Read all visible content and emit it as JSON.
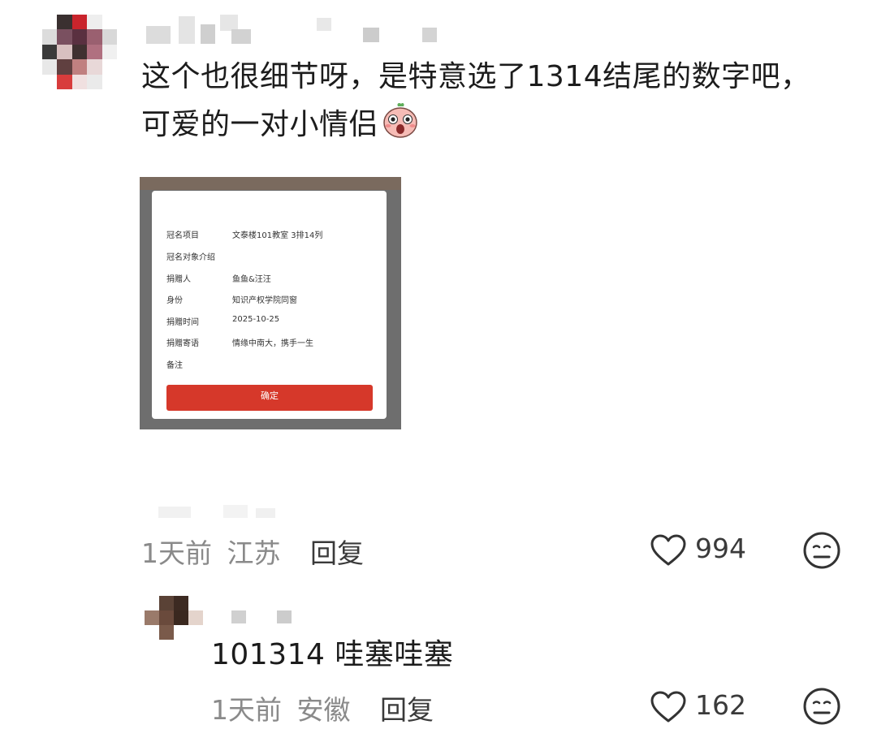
{
  "comments": [
    {
      "text_line1": "这个也很细节呀，是特意选了1314结尾的数字吧，",
      "text_line2": "可爱的一对小情侣",
      "emoji": "shocked-face-emoji",
      "time": "1天前",
      "location": "江苏",
      "reply_label": "回复",
      "likes": "994",
      "attached_image": {
        "fields": [
          {
            "key": "冠名项目",
            "value": "文泰楼101教室 3排14列"
          },
          {
            "key": "冠名对象介绍",
            "value": ""
          },
          {
            "key": "捐赠人",
            "value": "鱼鱼&汪汪"
          },
          {
            "key": "身份",
            "value": "知识产权学院同窗"
          },
          {
            "key": "捐赠时间",
            "value": "2025-10-25"
          },
          {
            "key": "捐赠寄语",
            "value": "情缘中南大，携手一生"
          },
          {
            "key": "备注",
            "value": ""
          }
        ],
        "confirm_label": "确定",
        "accent": "#d6382a"
      }
    },
    {
      "text_line1": "101314 哇塞哇塞",
      "time": "1天前",
      "location": "安徽",
      "reply_label": "回复",
      "likes": "162"
    }
  ],
  "icons": {
    "like": "heart-outline-icon",
    "reaction": "neutral-face-icon"
  }
}
